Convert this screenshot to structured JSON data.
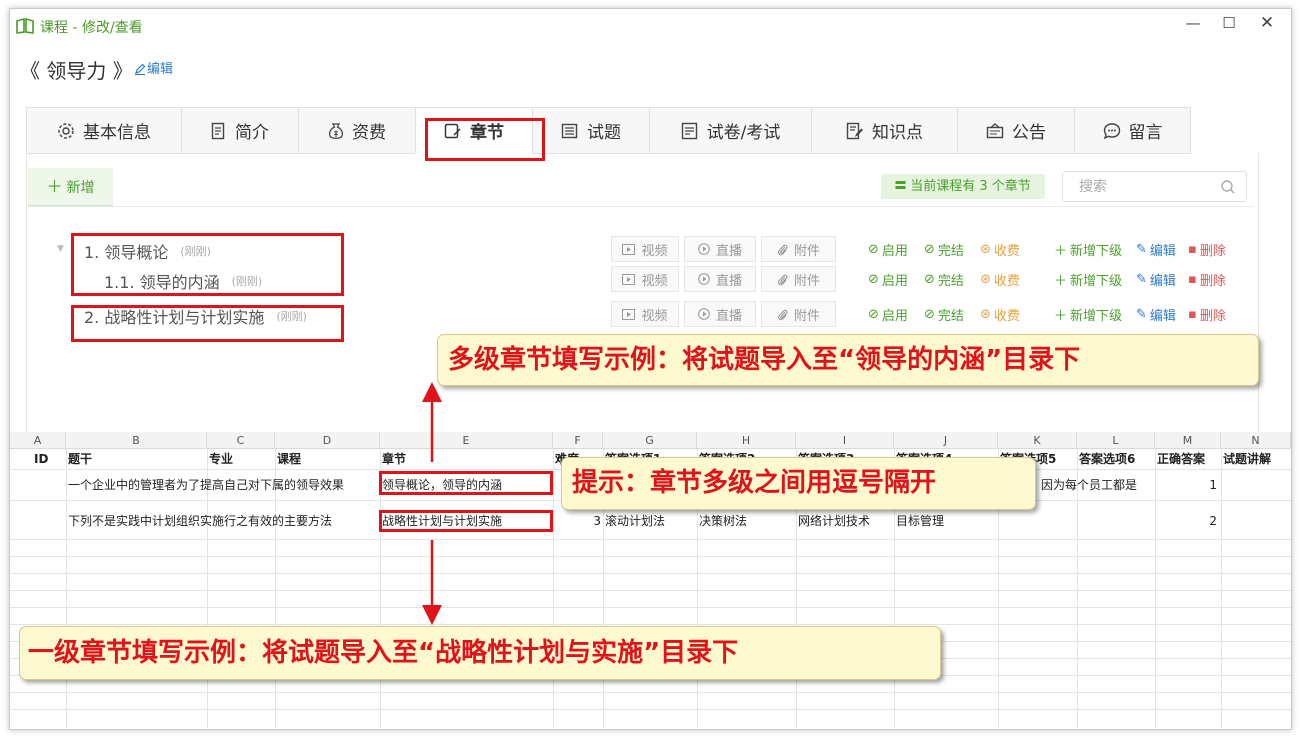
{
  "window": {
    "title": "课程 - 修改/查看",
    "controls": {
      "minimize": "—",
      "maximize": "☐",
      "close": "✕"
    }
  },
  "course": {
    "title": "《 领导力 》",
    "edit_label": "编辑"
  },
  "tabs": [
    {
      "label": "基本信息",
      "icon": "gear-icon"
    },
    {
      "label": "简介",
      "icon": "note-icon"
    },
    {
      "label": "资费",
      "icon": "money-bag-icon"
    },
    {
      "label": "章节",
      "icon": "chapter-icon",
      "active": true
    },
    {
      "label": "试题",
      "icon": "list-icon"
    },
    {
      "label": "试卷/考试",
      "icon": "paper-icon"
    },
    {
      "label": "知识点",
      "icon": "edit-doc-icon"
    },
    {
      "label": "公告",
      "icon": "notice-icon"
    },
    {
      "label": "留言",
      "icon": "chat-icon"
    }
  ],
  "toolbar": {
    "add_label": "新增",
    "count_badge": "当前课程有 3 个章节",
    "search_placeholder": "搜索"
  },
  "chapters": [
    {
      "title": "1. 领导概论",
      "time": "(刚刚)"
    },
    {
      "title": "1.1. 领导的内涵",
      "time": "(刚刚)"
    },
    {
      "title": "2. 战略性计划与计划实施",
      "time": "(刚刚)"
    }
  ],
  "chapter_actions": {
    "video": "视频",
    "live": "直播",
    "attachment": "附件",
    "enable": "启用",
    "finish": "完结",
    "charge": "收费",
    "add_child": "新增下级",
    "edit": "编辑",
    "delete": "删除"
  },
  "sheet": {
    "columns": [
      "A",
      "B",
      "C",
      "D",
      "E",
      "F",
      "G",
      "H",
      "I",
      "J",
      "K",
      "L",
      "M",
      "N"
    ],
    "header_row": [
      "ID",
      "题干",
      "专业",
      "课程",
      "章节",
      "难度",
      "答案选项1",
      "答案选项2",
      "答案选项3",
      "答案选项4",
      "答案选项5",
      "答案选项6",
      "正确答案",
      "试题讲解"
    ],
    "rows": [
      [
        "",
        "一个企业中的管理者为了提高自己对下属的领导效果",
        "",
        "",
        "领导概论，领导的内涵",
        "",
        "",
        "",
        "",
        "",
        "因为每个员工都是",
        "",
        "1",
        ""
      ],
      [
        "",
        "下列不是实践中计划组织实施行之有效的主要方法",
        "",
        "",
        "战略性计划与计划实施",
        "3",
        "滚动计划法",
        "决策树法",
        "网络计划技术",
        "目标管理",
        "",
        "",
        "2",
        ""
      ]
    ]
  },
  "annotations": {
    "multi_level": "多级章节填写示例：将试题导入至“领导的内涵”目录下",
    "hint": "提示：章节多级之间用逗号隔开",
    "single_level": "一级章节填写示例：将试题导入至“战略性计划与实施”目录下"
  },
  "colors": {
    "accent_green": "#4aa02c",
    "annotation_red": "#e1131a",
    "callout_bg": "#fff9d0"
  }
}
